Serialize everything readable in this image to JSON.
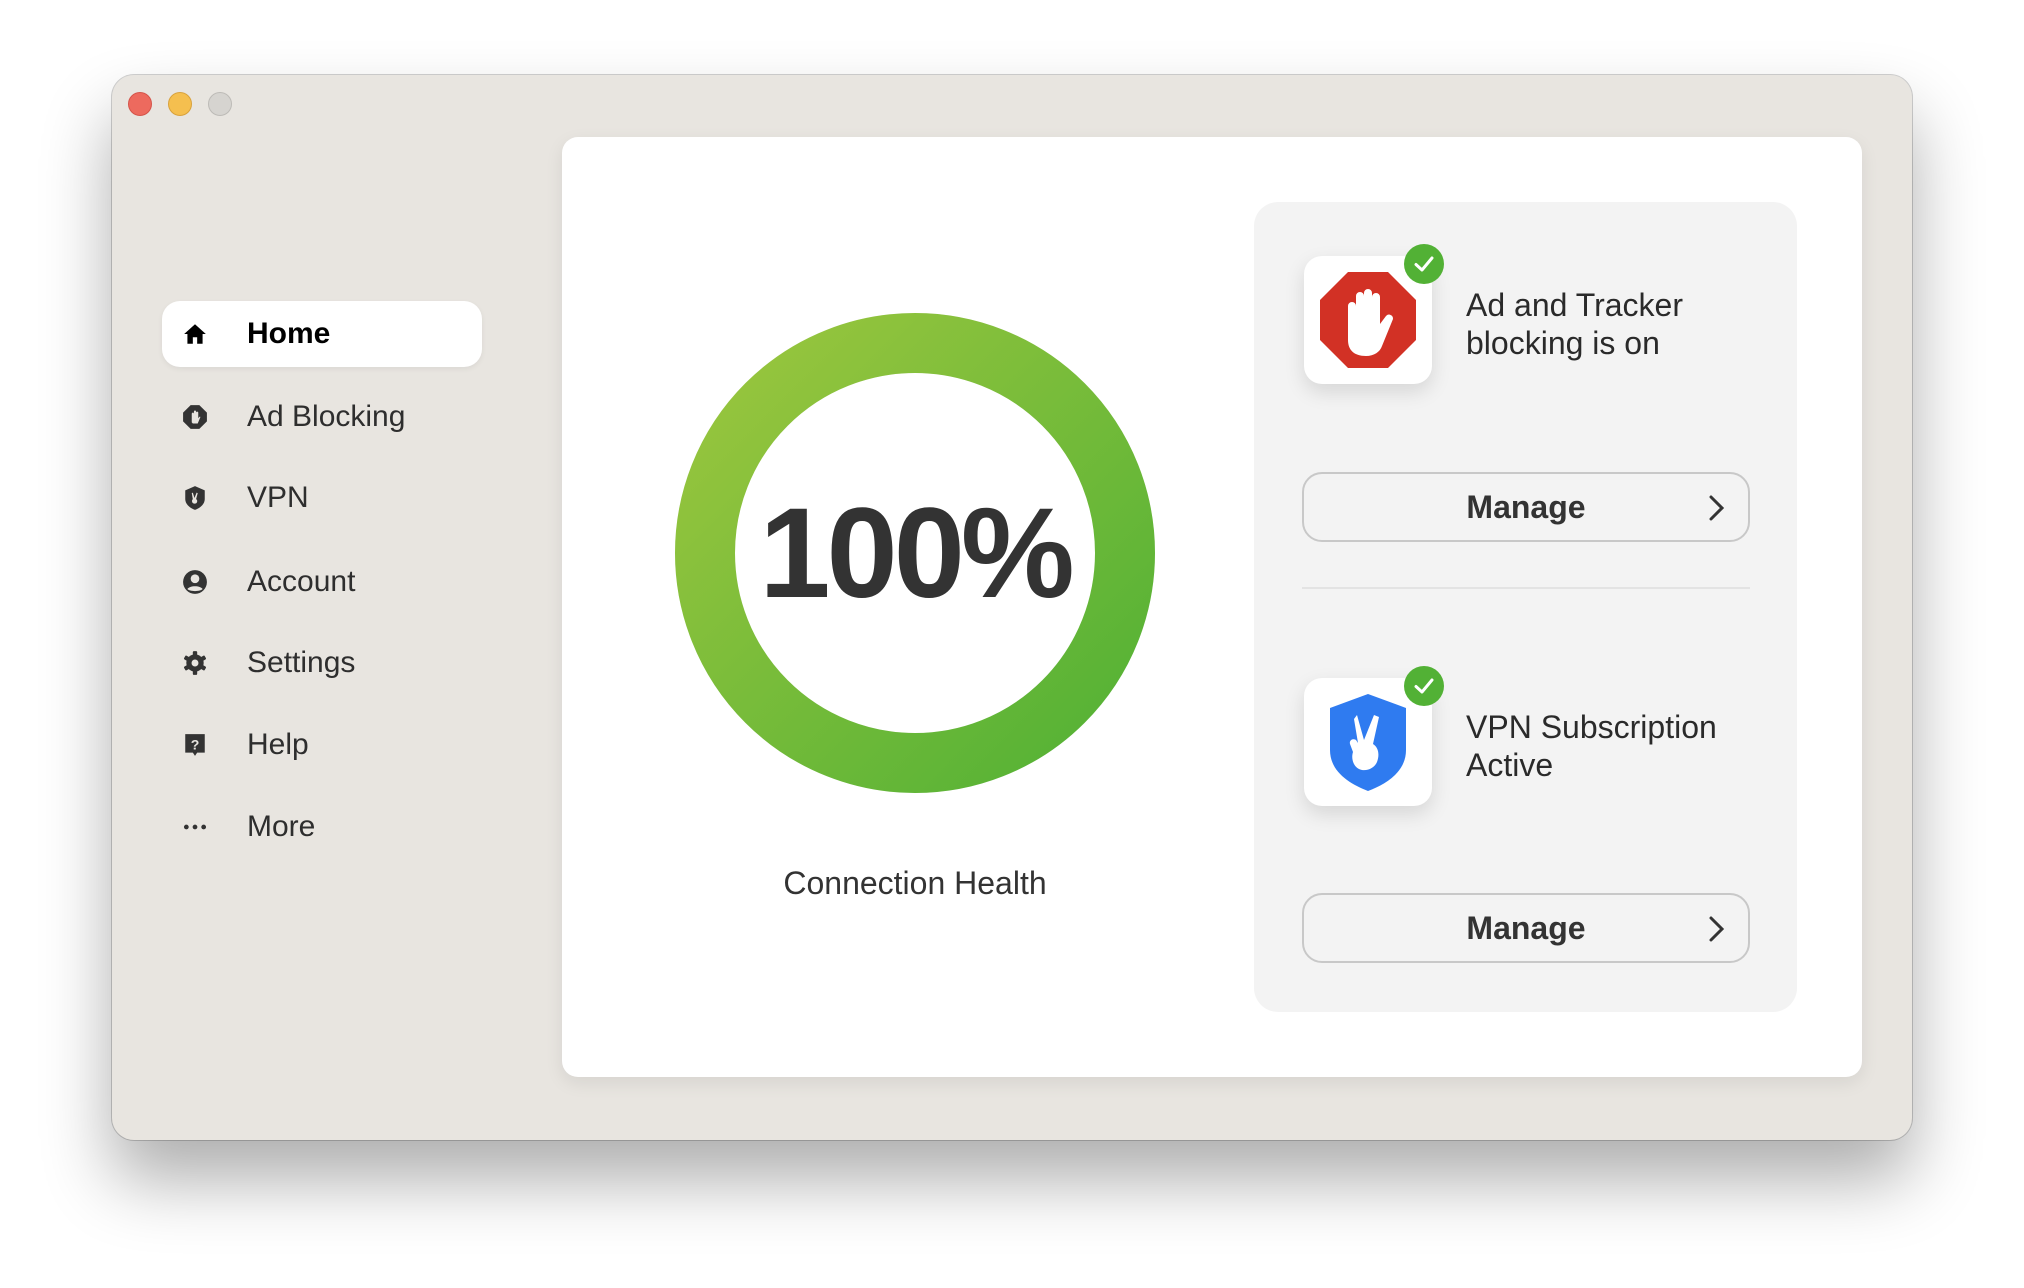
{
  "window": {
    "controls": [
      "close",
      "minimize",
      "maximize"
    ]
  },
  "sidebar": {
    "items": [
      {
        "label": "Home",
        "icon": "home-icon",
        "active": true
      },
      {
        "label": "Ad Blocking",
        "icon": "stop-hand-icon",
        "active": false
      },
      {
        "label": "VPN",
        "icon": "shield-peace-icon",
        "active": false
      },
      {
        "label": "Account",
        "icon": "user-circle-icon",
        "active": false
      },
      {
        "label": "Settings",
        "icon": "gear-icon",
        "active": false
      },
      {
        "label": "Help",
        "icon": "help-icon",
        "active": false
      },
      {
        "label": "More",
        "icon": "ellipsis-icon",
        "active": false
      }
    ]
  },
  "health": {
    "value_text": "100%",
    "value": 100,
    "label": "Connection Health",
    "colors": {
      "ring_start": "#52b135",
      "ring_end": "#9bc63e"
    }
  },
  "status": {
    "ad_blocking": {
      "text": "Ad and Tracker blocking is on",
      "line1": "Ad and Tracker",
      "line2": "blocking is on",
      "button": "Manage",
      "icon_color": "#d23125"
    },
    "vpn": {
      "text": "VPN Subscription Active",
      "line1": "VPN Subscription",
      "line2": "Active",
      "button": "Manage",
      "icon_color": "#2f7bf0"
    },
    "badge_color": "#52b135"
  }
}
